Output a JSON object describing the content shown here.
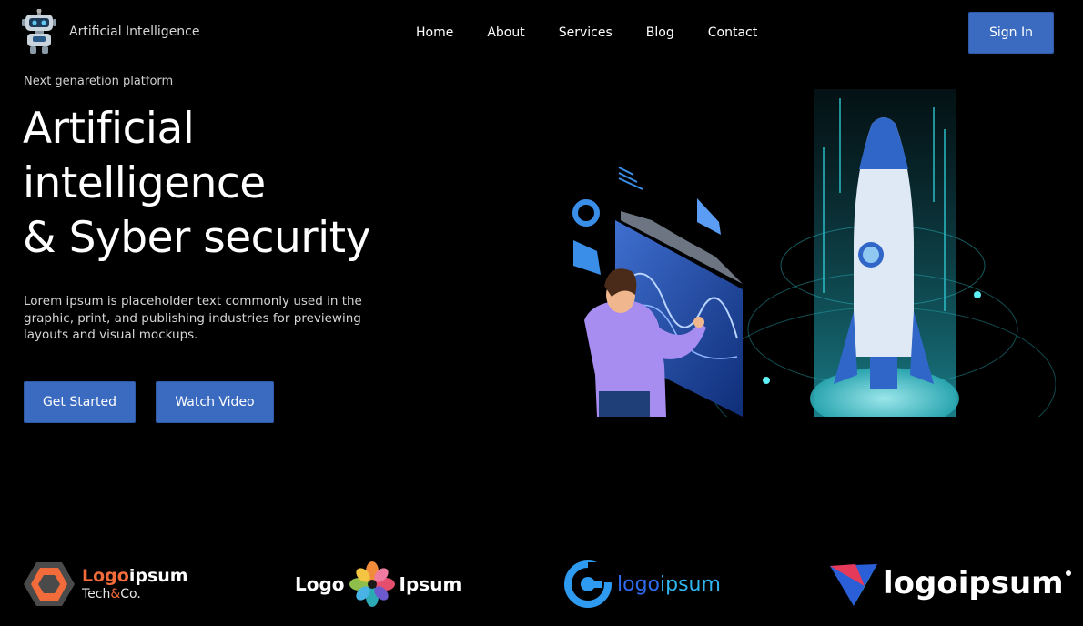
{
  "header": {
    "brand": "Artificial Intelligence",
    "nav": [
      "Home",
      "About",
      "Services",
      "Blog",
      "Contact"
    ],
    "sign_in": "Sign In"
  },
  "hero": {
    "eyebrow": "Next genaretion platform",
    "title_lines": [
      "Artificial",
      "intelligence",
      "& Syber security"
    ],
    "description": "Lorem ipsum is placeholder text commonly used in the graphic, print, and publishing industries for previewing layouts and visual mockups.",
    "get_started": "Get Started",
    "watch_video": "Watch Video"
  },
  "logos": {
    "l1_a": "Logo",
    "l1_b": "ipsum",
    "l1_c": "Tech",
    "l1_d": "&",
    "l1_e": "Co.",
    "l2_a": "Logo",
    "l2_b": "Ipsum",
    "l3_a": "logo",
    "l3_b": "ipsum",
    "l4": "logoipsum"
  },
  "colors": {
    "accent": "#3b6bc0",
    "background": "#000000",
    "logo_orange": "#f26b3a",
    "logo_blue": "#2f9bf0"
  }
}
